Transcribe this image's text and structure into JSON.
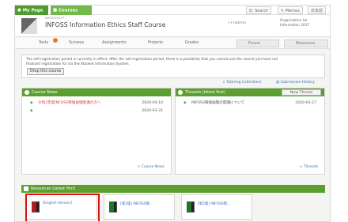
{
  "topbar": {
    "tabs": [
      {
        "label": "My Page"
      },
      {
        "label": "Courses"
      }
    ],
    "search": "Q. Search",
    "memos": "Memos",
    "lang": "日本語"
  },
  "course": {
    "code": "INFOSS2017P",
    "title": "INFOSS Information Ethics Staff Course",
    "author": "(+)admin",
    "org": "Organization for Information 2017"
  },
  "nav": {
    "items": [
      "Tests",
      "Surveys",
      "Assignments",
      "Projects",
      "Grades"
    ],
    "forum": "Forum",
    "resources": "Resources"
  },
  "notice": {
    "text": "The self registration period is currently in effect. After the self registration period, there is a possibility that you cannot use the course you have not finalized registration for via the Student Information System.",
    "button": "Drop this course"
  },
  "links": {
    "tutoring": "Tutoring Collections",
    "submission": "Submission History"
  },
  "news": {
    "title": "Course News",
    "items": [
      {
        "text": "令和2年度INFOSS情報倫理受講の方へ",
        "date": "2020-04-10"
      },
      {
        "text": "",
        "date": "2020-03-31"
      }
    ],
    "more": "> Course News"
  },
  "threads": {
    "title": "Threads (latest first)",
    "new_button": "New Thread",
    "items": [
      {
        "text": "INFOSS情報倫理の開講について",
        "date": "2020-03-27"
      }
    ],
    "more": "> Threads"
  },
  "resources": {
    "title": "Resources (latest first)",
    "items": [
      {
        "name": "[English Version]"
      },
      {
        "name": "[第2版] INFOSS情..."
      },
      {
        "name": "[第2版] INFOSS情..."
      }
    ]
  },
  "colors": {
    "green": "#5c9e2f",
    "highlight": "#e01010",
    "link": "#3a6fb0"
  }
}
